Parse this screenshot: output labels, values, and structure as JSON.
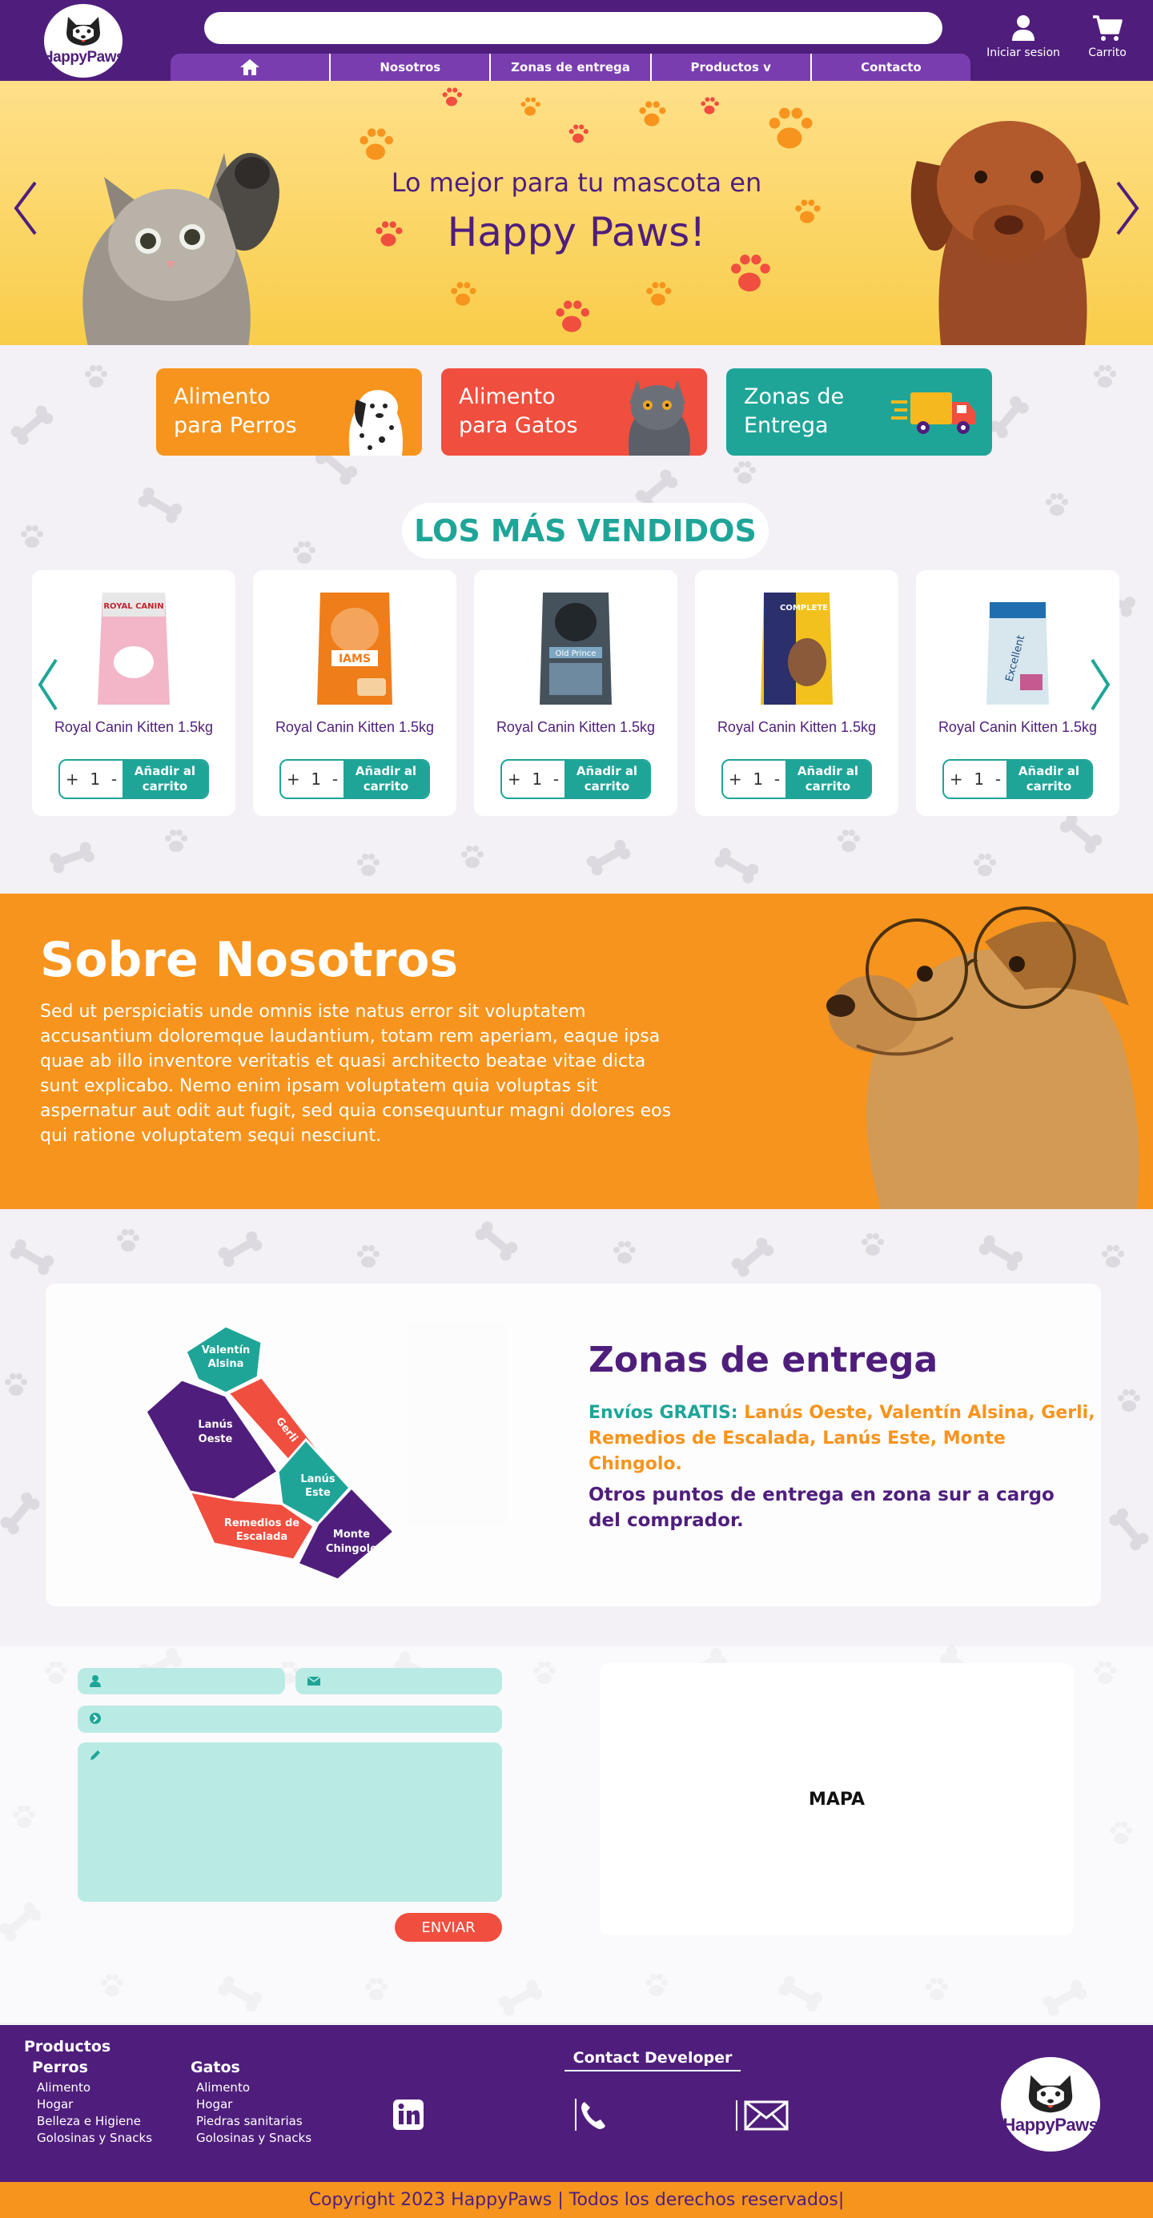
{
  "brand": {
    "logo_text": "HappyPaws"
  },
  "search": {
    "placeholder": ""
  },
  "nav": {
    "home_icon": "home-icon",
    "items": [
      "Nosotros",
      "Zonas de entrega",
      "Productos v",
      "Contacto"
    ]
  },
  "header_actions": {
    "login_label": "Iniciar sesion",
    "cart_label": "Carrito"
  },
  "hero": {
    "line1": "Lo mejor para tu mascota en",
    "line2": "Happy Paws!"
  },
  "categories": [
    {
      "line1": "Alimento",
      "line2": "para Perros",
      "color": "#f7941d"
    },
    {
      "line1": "Alimento",
      "line2": "para Gatos",
      "color": "#f04e3e"
    },
    {
      "line1": "Zonas de",
      "line2": "Entrega",
      "color": "#1fa598"
    }
  ],
  "best_sellers": {
    "title": "LOS MÁS VENDIDOS",
    "products": [
      {
        "name": "Royal Canin Kitten 1.5kg",
        "qty": "1",
        "bag_label": "ROYAL CANIN",
        "bag_color": "#f3b5c8"
      },
      {
        "name": "Royal Canin Kitten 1.5kg",
        "qty": "1",
        "bag_label": "IAMS",
        "bag_color": "#ef7d1a"
      },
      {
        "name": "Royal Canin Kitten 1.5kg",
        "qty": "1",
        "bag_label": "Old Prince",
        "bag_color": "#45525c"
      },
      {
        "name": "Royal Canin Kitten 1.5kg",
        "qty": "1",
        "bag_label": "COMPLETE",
        "bag_color": "#f2c11d"
      },
      {
        "name": "Royal Canin Kitten 1.5kg",
        "qty": "1",
        "bag_label": "Excellent",
        "bag_color": "#d8e6ee"
      }
    ],
    "add_label_1": "Añadir al",
    "add_label_2": "carrito",
    "plus": "+",
    "minus": "-"
  },
  "about": {
    "title": "Sobre Nosotros",
    "text": "Sed ut perspiciatis unde omnis iste natus error sit voluptatem accusantium doloremque laudantium, totam rem aperiam, eaque ipsa quae ab illo inventore veritatis et quasi architecto beatae vitae dicta sunt explicabo. Nemo enim ipsam voluptatem quia voluptas sit aspernatur aut odit aut fugit, sed quia consequuntur magni dolores eos qui ratione voluptatem sequi nesciunt."
  },
  "zones": {
    "title": "Zonas de entrega",
    "free_label": "Envíos GRATIS:",
    "free_list": "Lanús Oeste, Valentín Alsina, Gerli, Remedios de Escalada, Lanús Este, Monte Chingolo.",
    "other": "Otros puntos de entrega en zona sur a cargo del comprador.",
    "map_labels": [
      "Valentín",
      "Alsina",
      "Lanús",
      "Oeste",
      "Gerli",
      "Lanús",
      "Este",
      "Remedios de",
      "Escalada",
      "Monte",
      "Chingolo"
    ]
  },
  "contact": {
    "name_ph": "",
    "email_ph": "",
    "subject_ph": "",
    "message_ph": "",
    "send_label": "ENVIAR",
    "map_label": "MAPA"
  },
  "footer": {
    "products_title": "Productos",
    "dogs_title": "Perros",
    "dogs": [
      "Alimento",
      "Hogar",
      "Belleza e Higiene",
      "Golosinas y Snacks"
    ],
    "cats_title": "Gatos",
    "cats": [
      "Alimento",
      "Hogar",
      "Piedras sanitarias",
      "Golosinas y Snacks"
    ],
    "contact_dev": "Contact Developer",
    "logo_text": "HappyPaws"
  },
  "copyright": "Copyright 2023 HappyPaws | Todos los derechos reservados|",
  "colors": {
    "purple": "#4f1e7c",
    "orange": "#f7941d",
    "teal": "#1fa598",
    "red": "#f04e3e",
    "yellow": "#f8cd49"
  }
}
